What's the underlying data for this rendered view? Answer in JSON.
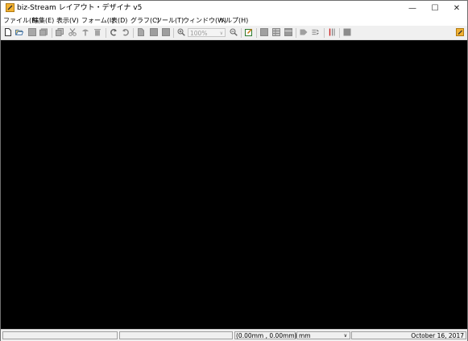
{
  "window": {
    "title": "biz-Stream レイアウト・デザイナ v5",
    "minimize": "—",
    "maximize": "☐",
    "close": "✕"
  },
  "menu": [
    "ファイル(F)",
    "編集(E)",
    "表示(V)",
    "フォーム(I)",
    "表(D)",
    "グラフ(C)",
    "ツール(T)",
    "ウィンドウ(W)",
    "ヘルプ(H)"
  ],
  "toolbar": {
    "zoom_value": "100%",
    "zoom_arrow": "∨"
  },
  "status": {
    "coordinates": "(0.00mm , 0.00mm)",
    "unit": "mm",
    "unit_arrow": "∨",
    "date": "October 16, 2017"
  },
  "colors": {
    "canvas": "#000000",
    "app_icon": "#f2b233"
  }
}
